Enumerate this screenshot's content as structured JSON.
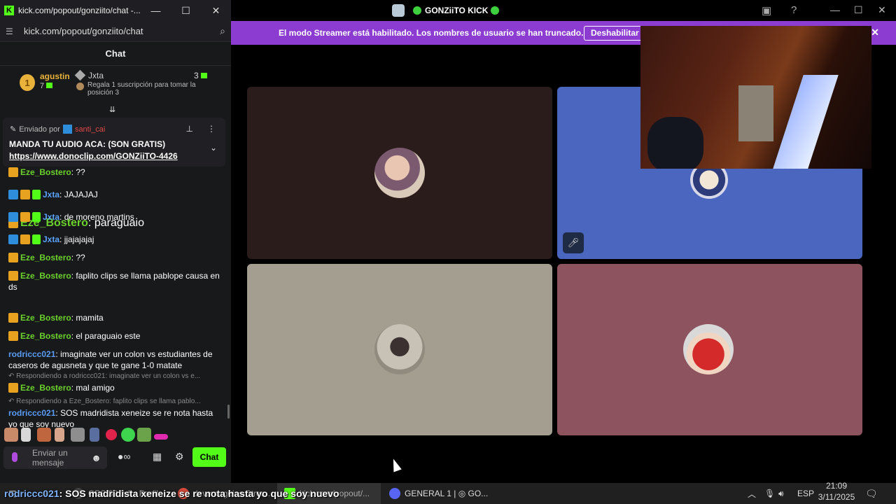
{
  "chat_window": {
    "title": "kick.com/popout/gonziito/chat -...",
    "url": "kick.com/popout/gonziito/chat",
    "header": "Chat",
    "leaderboard": {
      "first_rank": "1",
      "first_name": "agustin",
      "first_count": "7",
      "second_name": "Jxta",
      "second_count": "3",
      "gift_text": "Regala 1 suscripción para tomar la posición 3"
    },
    "pinned": {
      "sent_by_label": "Enviado por",
      "sender": "santi_cai",
      "message": "MANDA TU AUDIO ACA: (SON GRATIS)",
      "link": "https://www.donoclip.com/GONZiiTO-4426"
    },
    "partial_message": {
      "user": "Eze_Bostero",
      "text": "paraguaio"
    },
    "messages": [
      {
        "user": "Eze_Bostero",
        "text": "??",
        "badges": [
          "crown"
        ],
        "color": "green"
      },
      {
        "user": "Jxta",
        "text": "JAJAJAJ",
        "badges": [
          "blue",
          "crown",
          "green"
        ],
        "color": "blue"
      },
      {
        "user": "Jxta",
        "text": "de moreno martins",
        "badges": [
          "blue",
          "crown",
          "green"
        ],
        "color": "blue"
      },
      {
        "user": "Jxta",
        "text": "jjajajajaj",
        "badges": [
          "blue",
          "crown",
          "green"
        ],
        "color": "blue"
      },
      {
        "user": "Eze_Bostero",
        "text": "??",
        "badges": [
          "crown"
        ],
        "color": "green"
      },
      {
        "user": "Eze_Bostero",
        "text": "faplito clips se llama pablope causa en ds",
        "badges": [
          "crown"
        ],
        "color": "green"
      },
      {
        "user": "Eze_Bostero",
        "text": "mamita",
        "badges": [
          "crown"
        ],
        "color": "green"
      },
      {
        "user": "Eze_Bostero",
        "text": "el paraguaio este",
        "badges": [
          "crown"
        ],
        "color": "green"
      },
      {
        "user": "rodriccc021",
        "text": "imaginate ver un colon vs estudiantes de caseros de agusneta y que te gane 1-0 matate",
        "badges": [],
        "color": "blue2"
      },
      {
        "reply": "Respondiendo a rodriccc021: imaginate ver un colon vs e...",
        "user": "Eze_Bostero",
        "text": "mal amigo",
        "badges": [
          "crown"
        ],
        "color": "green"
      },
      {
        "reply": "Respondiendo a Eze_Bostero: faplito clips se llama pablo...",
        "user": "rodriccc021",
        "text": "SOS madridista xeneize se re nota hasta yo que soy nuevo",
        "badges": [],
        "color": "blue2"
      }
    ],
    "input_placeholder": "Enviar un mensaje",
    "chat_button": "Chat",
    "close_glyph": "✕",
    "minimize_glyph": "—",
    "maximize_glyph": "☐"
  },
  "discord": {
    "title": "GONZiiTO KICK",
    "banner_text": "El modo Streamer está habilitado. Los nombres de usuario se han truncado.",
    "banner_button": "Deshabilitar",
    "tile_colors": [
      "#2a1c1b",
      "#4a66bf",
      "#a39e90",
      "#8d5460"
    ]
  },
  "caption": {
    "user": "rodriccc021",
    "text": ": SOS madridista xeneize se re nota hasta yo que soy nuevo"
  },
  "taskbar": {
    "items": [
      "OBS 32.0.1 - Perfil:",
      "devmongeizo Strea...",
      "kick.com/popout/...",
      "GENERAL 1 | ◎ GO..."
    ],
    "language": "ESP",
    "time": "21:09",
    "date": "3/11/2025"
  }
}
